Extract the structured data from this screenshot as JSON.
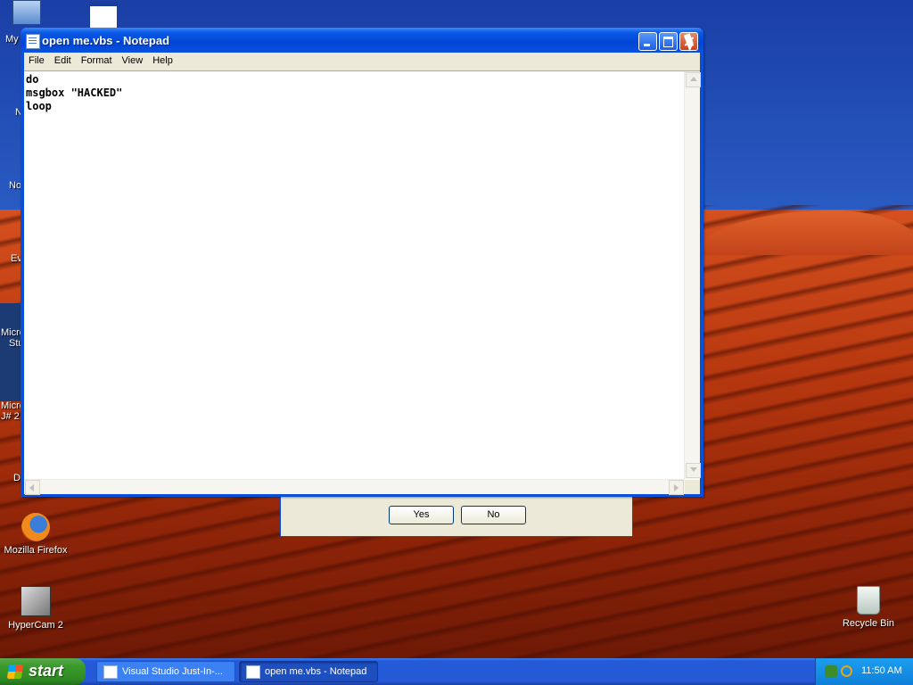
{
  "desktop": {
    "icons": [
      {
        "label": "Mozilla Firefox"
      },
      {
        "label": "HyperCam 2"
      },
      {
        "label": "Recycle Bin"
      }
    ],
    "edge_labels": [
      "My",
      "N",
      "No",
      "Ev",
      "Micro",
      "Stu",
      "Micro",
      "J# 2",
      "D"
    ]
  },
  "notepad": {
    "title": "open me.vbs - Notepad",
    "menu": [
      "File",
      "Edit",
      "Format",
      "View",
      "Help"
    ],
    "content_lines": [
      "do",
      "msgbox \"HACKED\"",
      "loop"
    ]
  },
  "msgbox": {
    "yes_label": "Yes",
    "no_label": "No"
  },
  "taskbar": {
    "start_label": "start",
    "tasks": [
      {
        "label": "Visual Studio Just-In-..."
      },
      {
        "label": "open me.vbs - Notepad"
      }
    ],
    "clock": "11:50 AM"
  },
  "colors": {
    "titlebar": "#0a4fd8",
    "start_button": "#3a9a2a",
    "taskbar": "#2459d8"
  }
}
